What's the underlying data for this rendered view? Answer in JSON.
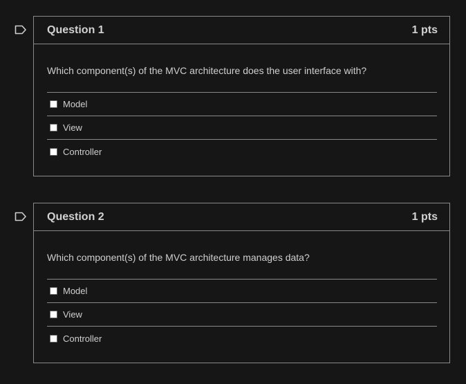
{
  "questions": [
    {
      "title": "Question 1",
      "points": "1 pts",
      "text": "Which component(s) of the MVC architecture does the user interface with?",
      "answers": [
        {
          "label": "Model"
        },
        {
          "label": "View"
        },
        {
          "label": "Controller"
        }
      ]
    },
    {
      "title": "Question 2",
      "points": "1 pts",
      "text": "Which component(s) of the MVC architecture manages data?",
      "answers": [
        {
          "label": "Model"
        },
        {
          "label": "View"
        },
        {
          "label": "Controller"
        }
      ]
    }
  ],
  "colors": {
    "background": "#161616",
    "border": "#8a8a8a",
    "text": "#d2d2d2",
    "flag": "#cfcfcf"
  },
  "icons": {
    "flag": "flag-question-icon"
  }
}
